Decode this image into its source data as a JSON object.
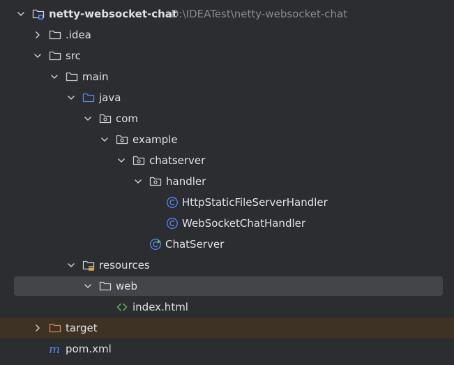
{
  "tree": {
    "root": {
      "label": "netty-websocket-chat",
      "path": "D:\\IDEATest\\netty-websocket-chat"
    },
    "idea": {
      "label": ".idea"
    },
    "src": {
      "label": "src"
    },
    "main": {
      "label": "main"
    },
    "java": {
      "label": "java"
    },
    "com": {
      "label": "com"
    },
    "example": {
      "label": "example"
    },
    "chatserver": {
      "label": "chatserver"
    },
    "handler": {
      "label": "handler"
    },
    "http_handler": {
      "label": "HttpStaticFileServerHandler"
    },
    "ws_handler": {
      "label": "WebSocketChatHandler"
    },
    "chat_server": {
      "label": "ChatServer"
    },
    "resources": {
      "label": "resources"
    },
    "web": {
      "label": "web"
    },
    "index_html": {
      "label": "index.html"
    },
    "target": {
      "label": "target"
    },
    "pom": {
      "label": "pom.xml"
    }
  },
  "colors": {
    "background": "#2b2d30",
    "selection": "#43454a",
    "excluded_row": "#3d3223",
    "text": "#dfe1e5",
    "path_text": "#868a91",
    "folder_stroke": "#ced0d6",
    "source_folder": "#548af7",
    "class_icon": "#548af7",
    "html_icon": "#5fb865",
    "excluded_folder": "#e08855",
    "maven_icon": "#4a8af4"
  }
}
